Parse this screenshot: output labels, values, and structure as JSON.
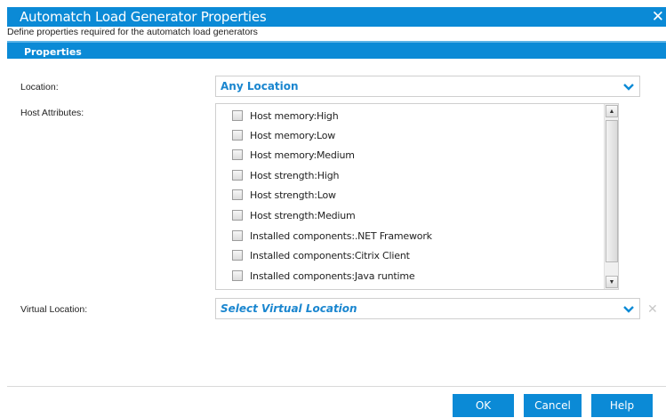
{
  "dialog": {
    "title": "Automatch Load Generator Properties",
    "close_glyph": "✕",
    "subtitle": "Define properties required for the automatch load generators"
  },
  "section": {
    "header": "Properties"
  },
  "location": {
    "label": "Location:",
    "value": "Any Location"
  },
  "host_attributes": {
    "label": "Host Attributes:",
    "items": [
      {
        "label": "Host memory:High",
        "checked": false
      },
      {
        "label": "Host memory:Low",
        "checked": false
      },
      {
        "label": "Host memory:Medium",
        "checked": false
      },
      {
        "label": "Host strength:High",
        "checked": false
      },
      {
        "label": "Host strength:Low",
        "checked": false
      },
      {
        "label": "Host strength:Medium",
        "checked": false
      },
      {
        "label": "Installed components:.NET Framework",
        "checked": false
      },
      {
        "label": "Installed components:Citrix Client",
        "checked": false
      },
      {
        "label": "Installed components:Java runtime",
        "checked": false
      }
    ]
  },
  "virtual_location": {
    "label": "Virtual Location:",
    "placeholder": "Select Virtual Location",
    "clear_glyph": "✕"
  },
  "buttons": {
    "ok": "OK",
    "cancel": "Cancel",
    "help": "Help"
  },
  "colors": {
    "accent": "#0b8ad6",
    "link_text": "#1a86cf"
  }
}
